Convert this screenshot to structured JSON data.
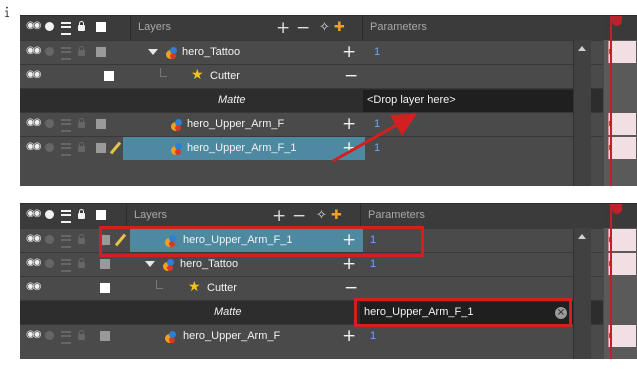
{
  "page_marker": "1",
  "colors": {
    "panel": "#4a4a4a",
    "header": "#3b3b3b",
    "selected_row": "#4d8aa2",
    "param_blue": "#6aa6ff",
    "annotation_red": "#d31f1f",
    "playhead": "#c0202a"
  },
  "top_panel": {
    "layers_header": "Layers",
    "parameters_header": "Parameters",
    "rows": [
      {
        "name": "hero_Tattoo",
        "param": "1",
        "icon": "drawing-layer-icon",
        "expanded": true
      },
      {
        "name": "Cutter",
        "icon": "star-icon",
        "action": "−"
      },
      {
        "name": "Matte",
        "field": "<Drop layer here>"
      },
      {
        "name": "hero_Upper_Arm_F",
        "param": "1",
        "icon": "drawing-layer-icon"
      },
      {
        "name": "hero_Upper_Arm_F_1",
        "param": "1",
        "icon": "drawing-layer-icon",
        "selected": true
      }
    ]
  },
  "bottom_panel": {
    "layers_header": "Layers",
    "parameters_header": "Parameters",
    "rows": [
      {
        "name": "hero_Upper_Arm_F_1",
        "param": "1",
        "icon": "drawing-layer-icon",
        "selected": true
      },
      {
        "name": "hero_Tattoo",
        "param": "1",
        "icon": "drawing-layer-icon",
        "expanded": true
      },
      {
        "name": "Cutter",
        "icon": "star-icon",
        "action": "−"
      },
      {
        "name": "Matte",
        "field": "hero_Upper_Arm_F_1"
      },
      {
        "name": "hero_Upper_Arm_F",
        "param": "1",
        "icon": "drawing-layer-icon"
      }
    ]
  }
}
